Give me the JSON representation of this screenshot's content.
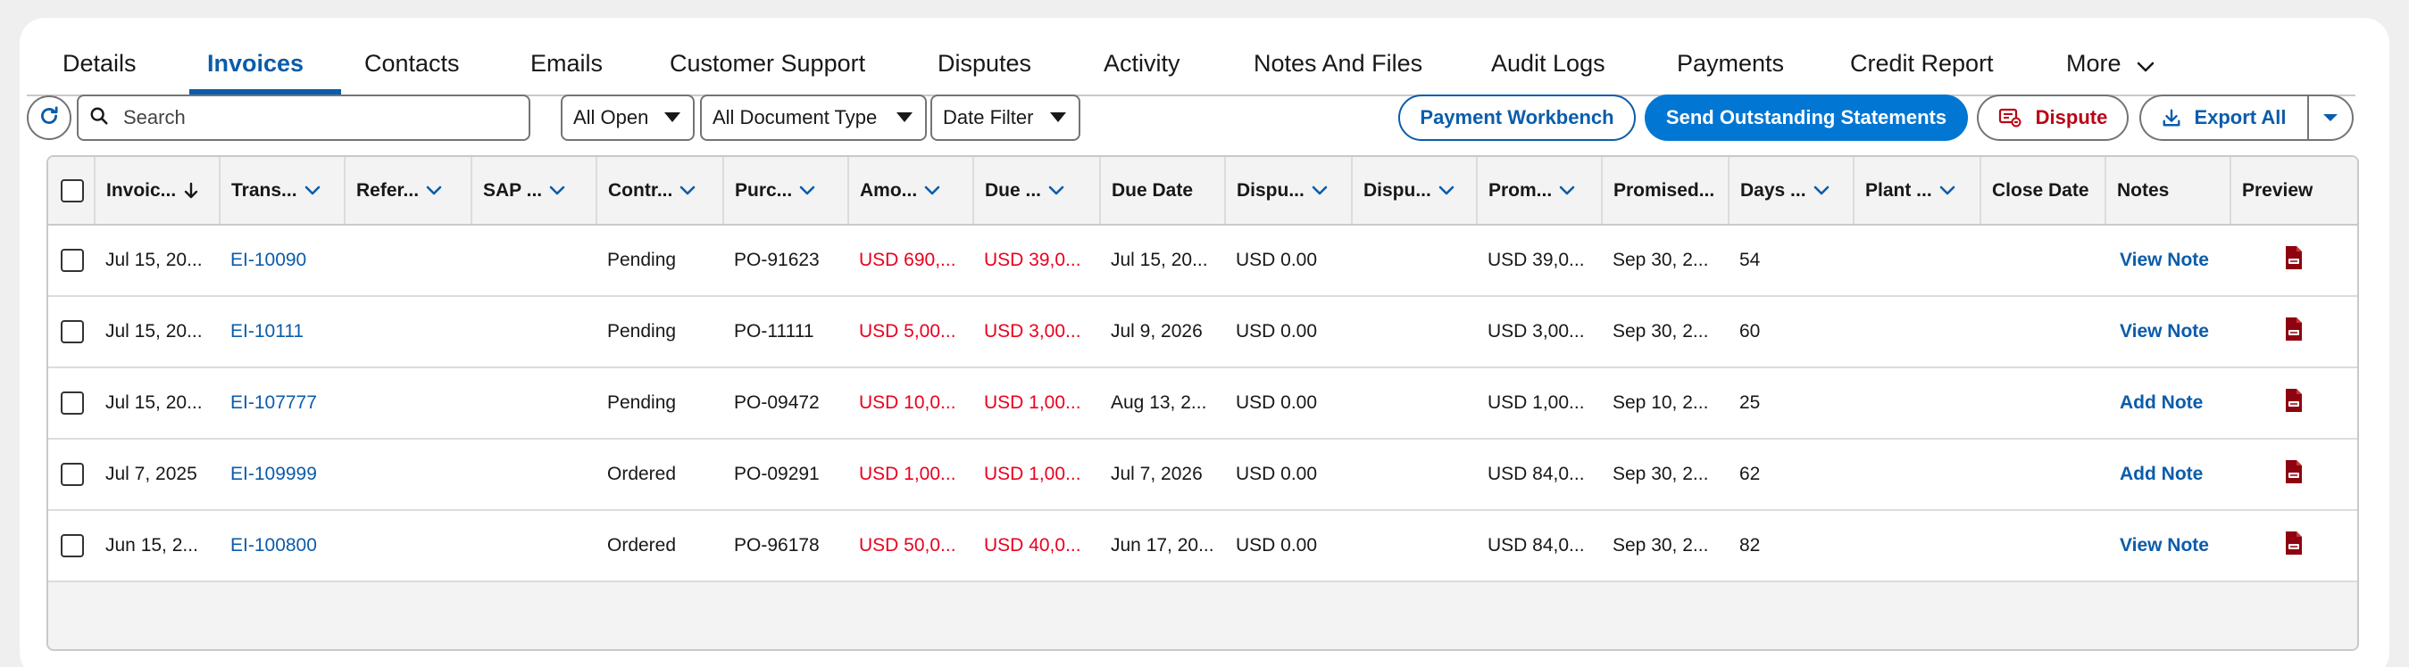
{
  "tabs": [
    {
      "label": "Details"
    },
    {
      "label": "Invoices"
    },
    {
      "label": "Contacts"
    },
    {
      "label": "Emails"
    },
    {
      "label": "Customer Support"
    },
    {
      "label": "Disputes"
    },
    {
      "label": "Activity"
    },
    {
      "label": "Notes And Files"
    },
    {
      "label": "Audit Logs"
    },
    {
      "label": "Payments"
    },
    {
      "label": "Credit Report"
    },
    {
      "label": "More"
    }
  ],
  "active_tab": "Invoices",
  "toolbar": {
    "search_placeholder": "Search",
    "status_filter": "All Open",
    "doc_type_filter": "All Document Type",
    "date_filter": "Date Filter",
    "payment_workbench": "Payment Workbench",
    "send_statements": "Send Outstanding Statements",
    "dispute": "Dispute",
    "export_all": "Export All"
  },
  "table": {
    "columns": [
      "Invoic...",
      "Trans...",
      "Refer...",
      "SAP ...",
      "Contr...",
      "Purc...",
      "Amo...",
      "Due ...",
      "Due Date",
      "Dispu...",
      "Dispu...",
      "Prom...",
      "Promised...",
      "Days ...",
      "Plant ...",
      "Close Date",
      "Notes",
      "Preview"
    ],
    "rows": [
      [
        "Jul 15, 20...",
        "EI-10090",
        "",
        "",
        "Pending",
        "PO-91623",
        "USD 690,...",
        "USD 39,0...",
        "Jul 15, 20...",
        "USD 0.00",
        "",
        "USD 39,0...",
        "Sep 30, 2...",
        "54",
        "",
        "",
        "View Note"
      ],
      [
        "Jul 15, 20...",
        "EI-10111",
        "",
        "",
        "Pending",
        "PO-11111",
        "USD 5,00...",
        "USD 3,00...",
        "Jul 9, 2026",
        "USD 0.00",
        "",
        "USD 3,00...",
        "Sep 30, 2...",
        "60",
        "",
        "",
        "View Note"
      ],
      [
        "Jul 15, 20...",
        "EI-107777",
        "",
        "",
        "Pending",
        "PO-09472",
        "USD 10,0...",
        "USD 1,00...",
        "Aug 13, 2...",
        "USD 0.00",
        "",
        "USD 1,00...",
        "Sep 10, 2...",
        "25",
        "",
        "",
        "Add Note"
      ],
      [
        "Jul 7, 2025",
        "EI-109999",
        "",
        "",
        "Ordered",
        "PO-09291",
        "USD 1,00...",
        "USD 1,00...",
        "Jul 7, 2026",
        "USD 0.00",
        "",
        "USD 84,0...",
        "Sep 30, 2...",
        "62",
        "",
        "",
        "Add Note"
      ],
      [
        "Jun 15, 2...",
        "EI-100800",
        "",
        "",
        "Ordered",
        "PO-96178",
        "USD 50,0...",
        "USD 40,0...",
        "Jun 17, 20...",
        "USD 0.00",
        "",
        "USD 84,0...",
        "Sep 30, 2...",
        "82",
        "",
        "",
        "View Note"
      ]
    ]
  },
  "colors": {
    "brand": "#0176d3",
    "link": "#0b5cab",
    "negative": "#ea001e",
    "pdf": "#8e030f"
  }
}
